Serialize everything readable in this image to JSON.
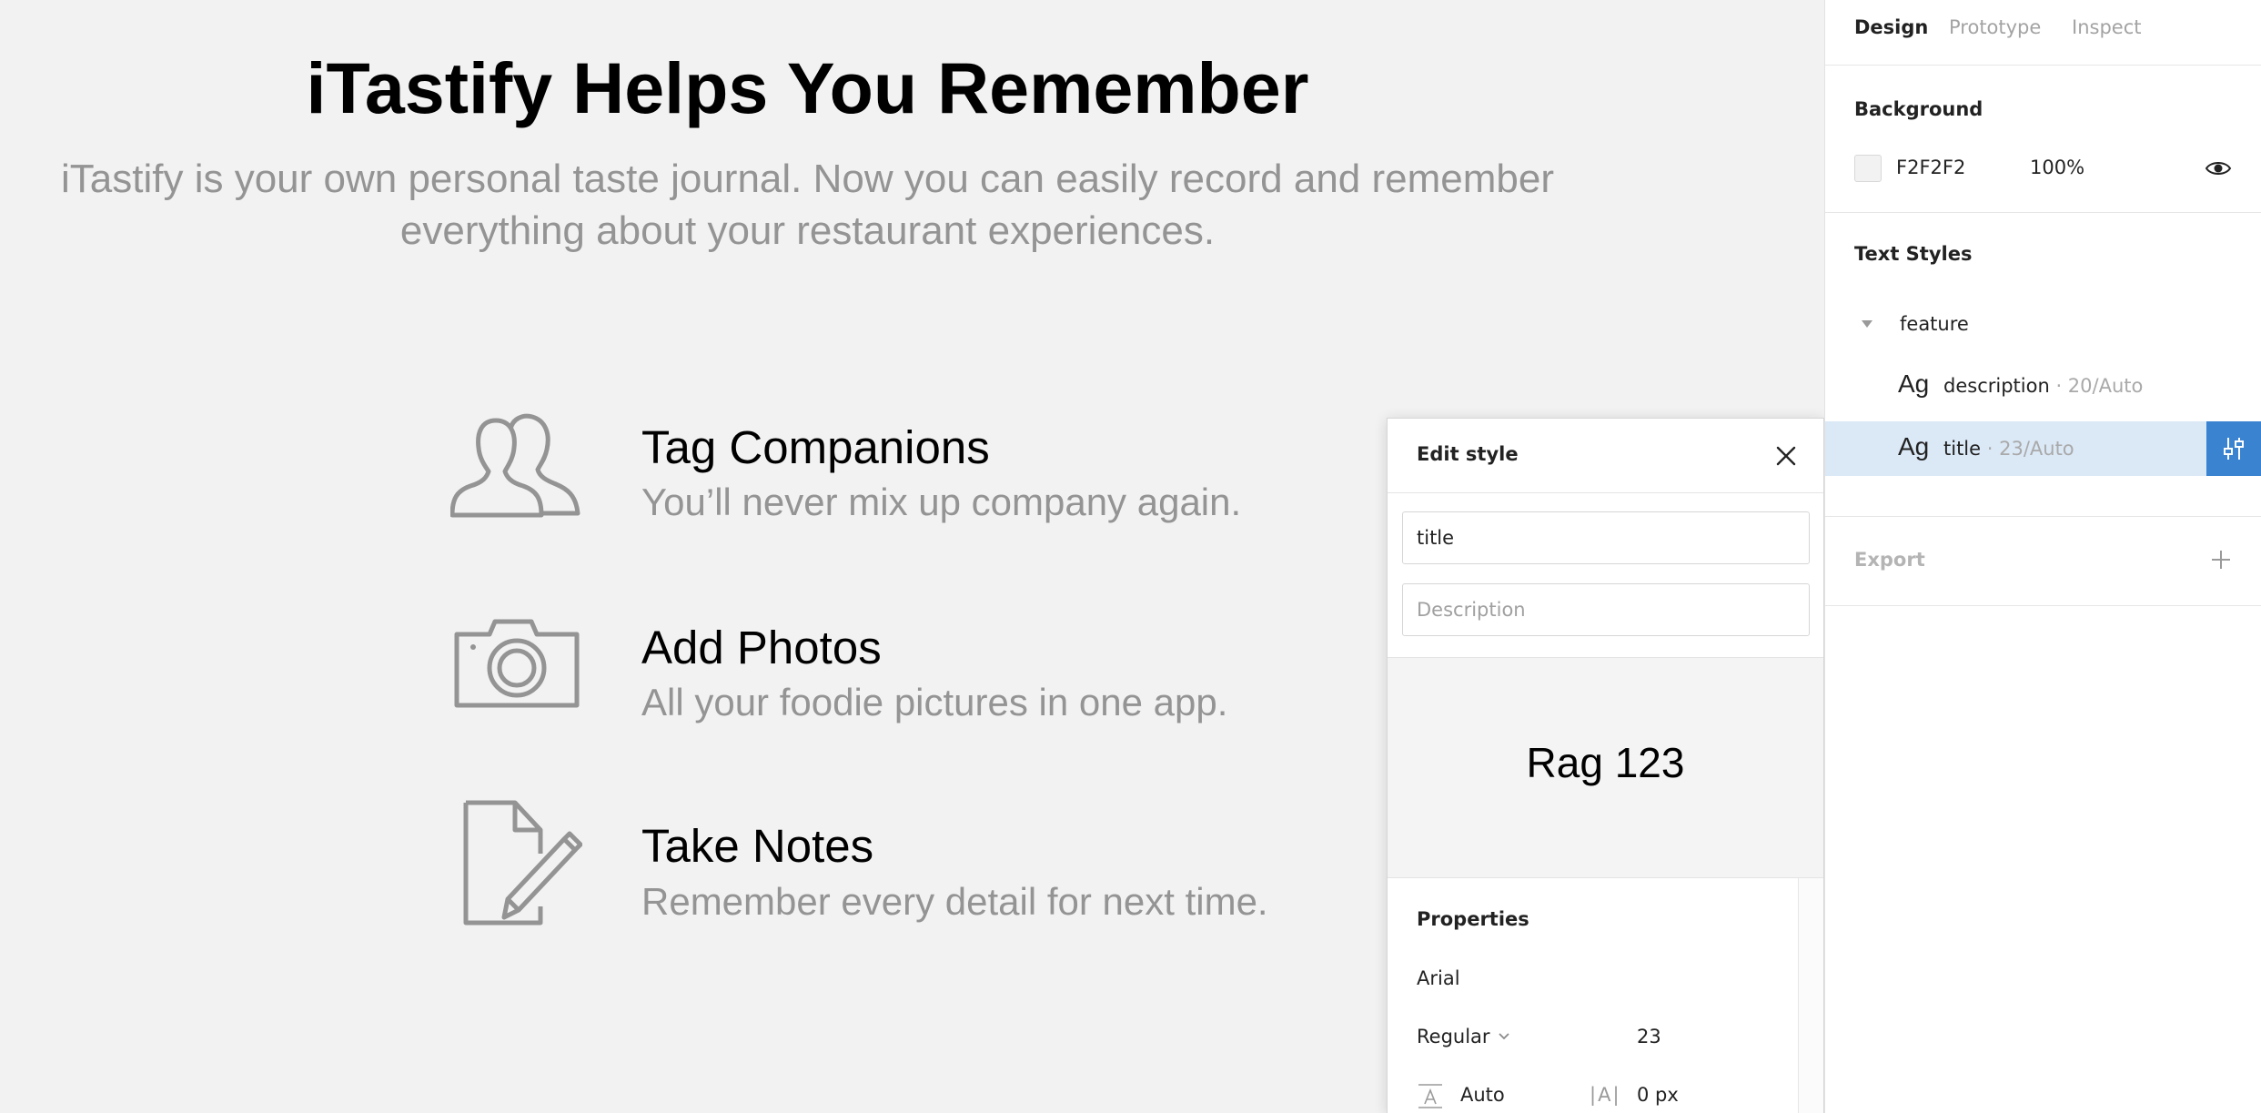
{
  "canvas": {
    "background": "#F2F2F2",
    "title": "iTastify Helps You Remember",
    "subtitle_line1": "iTastify is your own personal taste journal. Now you can easily record and remember",
    "subtitle_line2": "everything about your restaurant experiences.",
    "features": [
      {
        "icon": "companions-icon",
        "title": "Tag Companions",
        "description": "You’ll never mix up company again."
      },
      {
        "icon": "camera-icon",
        "title": "Add Photos",
        "description": "All your foodie pictures in one app."
      },
      {
        "icon": "notes-pencil-icon",
        "title": "Take Notes",
        "description": "Remember every detail for next time."
      }
    ]
  },
  "edit_style": {
    "header": "Edit style",
    "name_value": "title",
    "description_placeholder": "Description",
    "preview_text": "Rag 123",
    "properties_label": "Properties",
    "font_family": "Arial",
    "font_weight": "Regular",
    "font_size": "23",
    "line_height": "Auto",
    "letter_spacing": "0 px",
    "letter_spacing_glyph": "|A|"
  },
  "panel": {
    "tabs": [
      "Design",
      "Prototype",
      "Inspect"
    ],
    "active_tab": "Design",
    "background_label": "Background",
    "background_hex": "F2F2F2",
    "background_opacity": "100%",
    "text_styles_label": "Text Styles",
    "group_name": "feature",
    "styles": [
      {
        "glyph": "Ag",
        "name": "description",
        "meta": "· 20/Auto",
        "selected": false
      },
      {
        "glyph": "Ag",
        "name": "title",
        "meta": "· 23/Auto",
        "selected": true
      }
    ],
    "export_label": "Export",
    "accent_color": "#3A83D1",
    "selected_row_color": "#DBE8F6"
  }
}
